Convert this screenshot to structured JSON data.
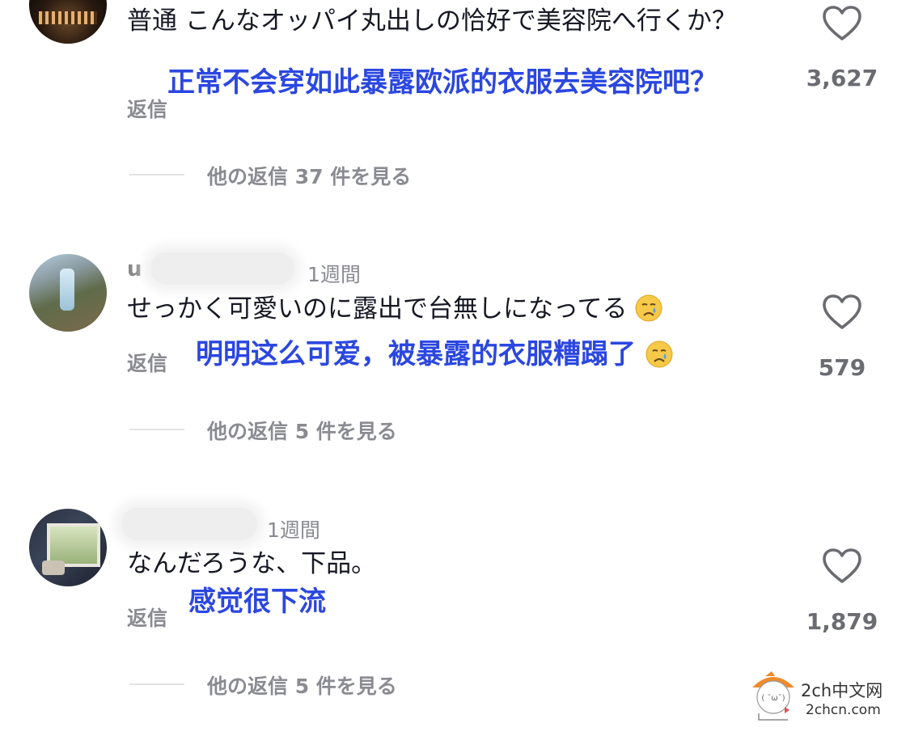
{
  "comments": [
    {
      "username_tail": "",
      "time": "",
      "text": "普通 こんなオッパイ丸出しの恰好で美容院へ行くか？",
      "translation": "正常不会穿如此暴露欧派的衣服去美容院吧？",
      "reply_label": "返信",
      "likes": "3,627",
      "more_replies": "他の返信 37 件を見る"
    },
    {
      "username_tail": "u",
      "time": "1週間",
      "text": "せっかく可愛いのに露出で台無しになってる",
      "translation": "明明这么可爱，被暴露的衣服糟蹋了",
      "reply_label": "返信",
      "likes": "579",
      "more_replies": "他の返信 5 件を見る"
    },
    {
      "username_tail": "",
      "time": "1週間",
      "text": "なんだろうな、下品。",
      "translation": "感觉很下流",
      "reply_label": "返信",
      "likes": "1,879",
      "more_replies": "他の返信 5 件を見る"
    }
  ],
  "watermark": {
    "line1": "2ch中文网",
    "line2": "2chcn.com"
  },
  "colors": {
    "translation": "#2b47e0",
    "muted": "#8a8b91",
    "text": "#161823"
  }
}
